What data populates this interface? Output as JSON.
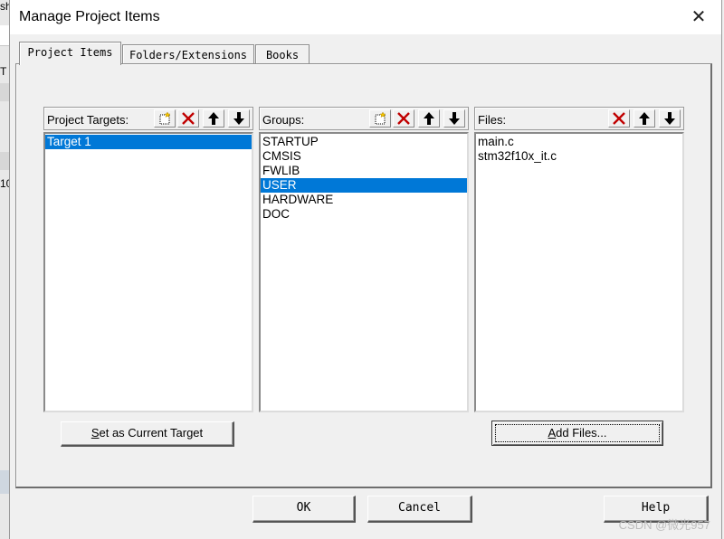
{
  "dialog": {
    "title": "Manage Project Items",
    "close_glyph": "✕"
  },
  "tabs": [
    {
      "label": "Project Items",
      "active": true
    },
    {
      "label": "Folders/Extensions",
      "active": false
    },
    {
      "label": "Books",
      "active": false
    }
  ],
  "targets": {
    "label": "Project Targets:",
    "items": [
      {
        "text": "Target 1",
        "selected": true
      }
    ]
  },
  "groups": {
    "label": "Groups:",
    "items": [
      {
        "text": "STARTUP",
        "selected": false
      },
      {
        "text": "CMSIS",
        "selected": false
      },
      {
        "text": "FWLIB",
        "selected": false
      },
      {
        "text": "USER",
        "selected": true
      },
      {
        "text": "HARDWARE",
        "selected": false
      },
      {
        "text": "DOC",
        "selected": false
      }
    ]
  },
  "files": {
    "label": "Files:",
    "items": [
      {
        "text": "main.c",
        "selected": false
      },
      {
        "text": "stm32f10x_it.c",
        "selected": false
      }
    ]
  },
  "buttons": {
    "set_current_target": "Set as Current Target",
    "add_files": "Add Files...",
    "ok": "OK",
    "cancel": "Cancel",
    "help": "Help"
  },
  "toolbar_icons": [
    "new-item-icon",
    "delete-icon",
    "move-up-icon",
    "move-down-icon"
  ],
  "colors": {
    "selection": "#0078d7",
    "delete_red": "#c00000"
  },
  "background_app": {
    "fragments": [
      "sh",
      "T",
      "10"
    ]
  },
  "watermark": "CSDN @微光957"
}
